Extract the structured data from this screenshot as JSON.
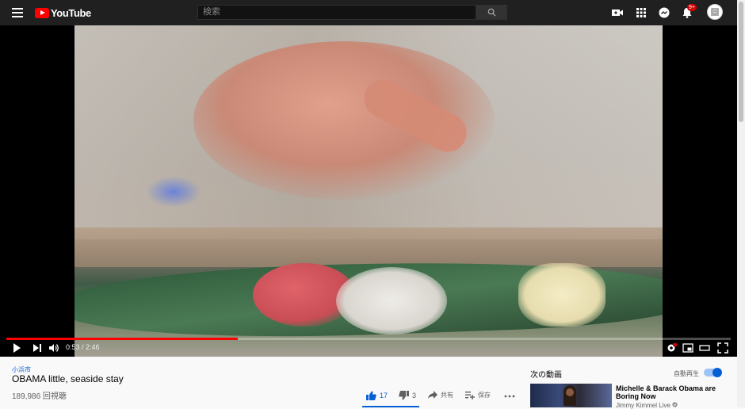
{
  "header": {
    "logo_text": "YouTube",
    "search_placeholder": "検索",
    "notification_count": "9+",
    "accent_color": "#ff0000"
  },
  "player": {
    "current_time": "0:53",
    "duration": "2:46",
    "time_display": "0:53 / 2:46",
    "progress_fraction": 0.319
  },
  "video": {
    "channel": "小浜市",
    "title": "OBAMA little, seaside stay",
    "views": "189,986 回視聴",
    "likes": "17",
    "dislikes": "3",
    "share_label": "共有",
    "save_label": "保存"
  },
  "sidebar": {
    "up_next_label": "次の動画",
    "autoplay_label": "自動再生",
    "autoplay_on": true,
    "recommendations": [
      {
        "title": "Michelle & Barack Obama are Boring Now",
        "channel": "Jimmy Kimmel Live"
      }
    ]
  }
}
